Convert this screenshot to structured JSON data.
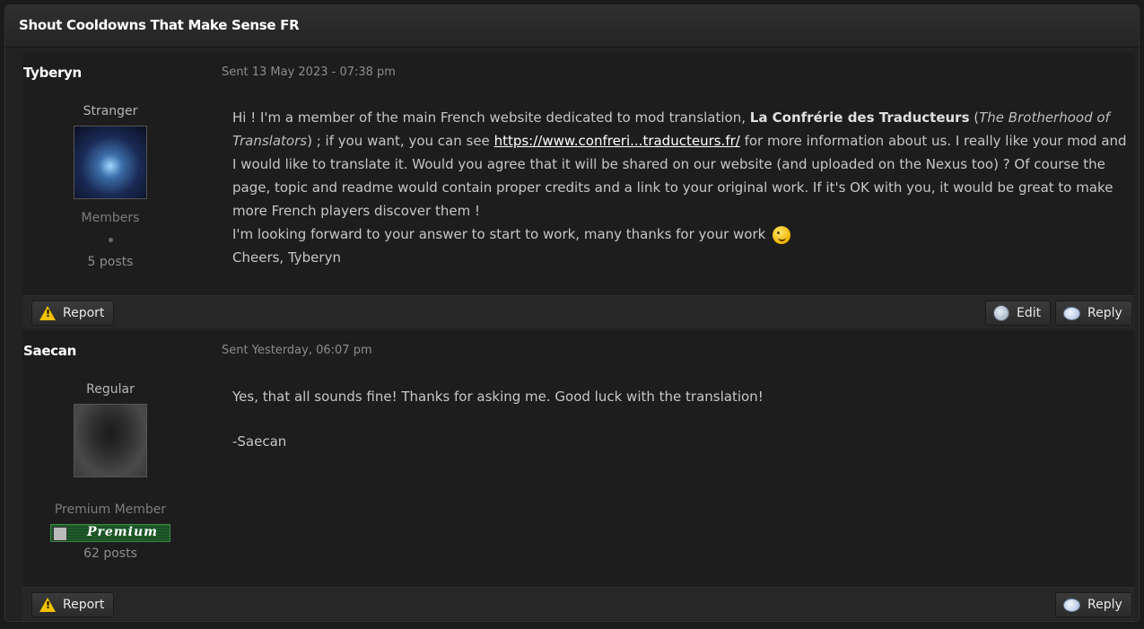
{
  "topic": {
    "title": "Shout Cooldowns That Make Sense FR"
  },
  "posts": [
    {
      "author": "Tyberyn",
      "sent": "Sent 13 May 2023 - 07:38 pm",
      "rank": "Stranger",
      "group": "Members",
      "posts": "5 posts",
      "body": {
        "p1_a": "Hi ! I'm a member of the main French website dedicated to mod translation, ",
        "p1_bold": "La Confrérie des Traducteurs",
        "p1_b": " (",
        "p1_italic": "The Brotherhood of Translators",
        "p1_c": ") ; if you want, you can see ",
        "p1_link": "https://www.confreri...traducteurs.fr/",
        "p1_d": " for more information about us. I really like your mod and I would like to translate it. Would you agree that it will be shared on our website (and uploaded on the Nexus too) ? Of course the page, topic and readme would contain proper credits and a link to your original work. If it's OK with you, it would be great to make more French players discover them !",
        "p2": "I'm looking forward to your answer to start to work, many thanks for your work",
        "p3": "Cheers, Tyberyn"
      },
      "buttons": {
        "report": "Report",
        "edit": "Edit",
        "reply": "Reply"
      }
    },
    {
      "author": "Saecan",
      "sent": "Sent Yesterday, 06:07 pm",
      "rank": "Regular",
      "group": "Premium Member",
      "badge": "Premium",
      "posts": "62 posts",
      "body": {
        "p1": "Yes, that all sounds fine! Thanks for asking me. Good luck with the translation!",
        "p2": "-Saecan"
      },
      "buttons": {
        "report": "Report",
        "reply": "Reply"
      }
    }
  ],
  "icons": {
    "report": "warning-icon",
    "edit": "edit-icon",
    "reply": "reply-bubble-icon",
    "smiley": "wink-smiley-icon"
  }
}
